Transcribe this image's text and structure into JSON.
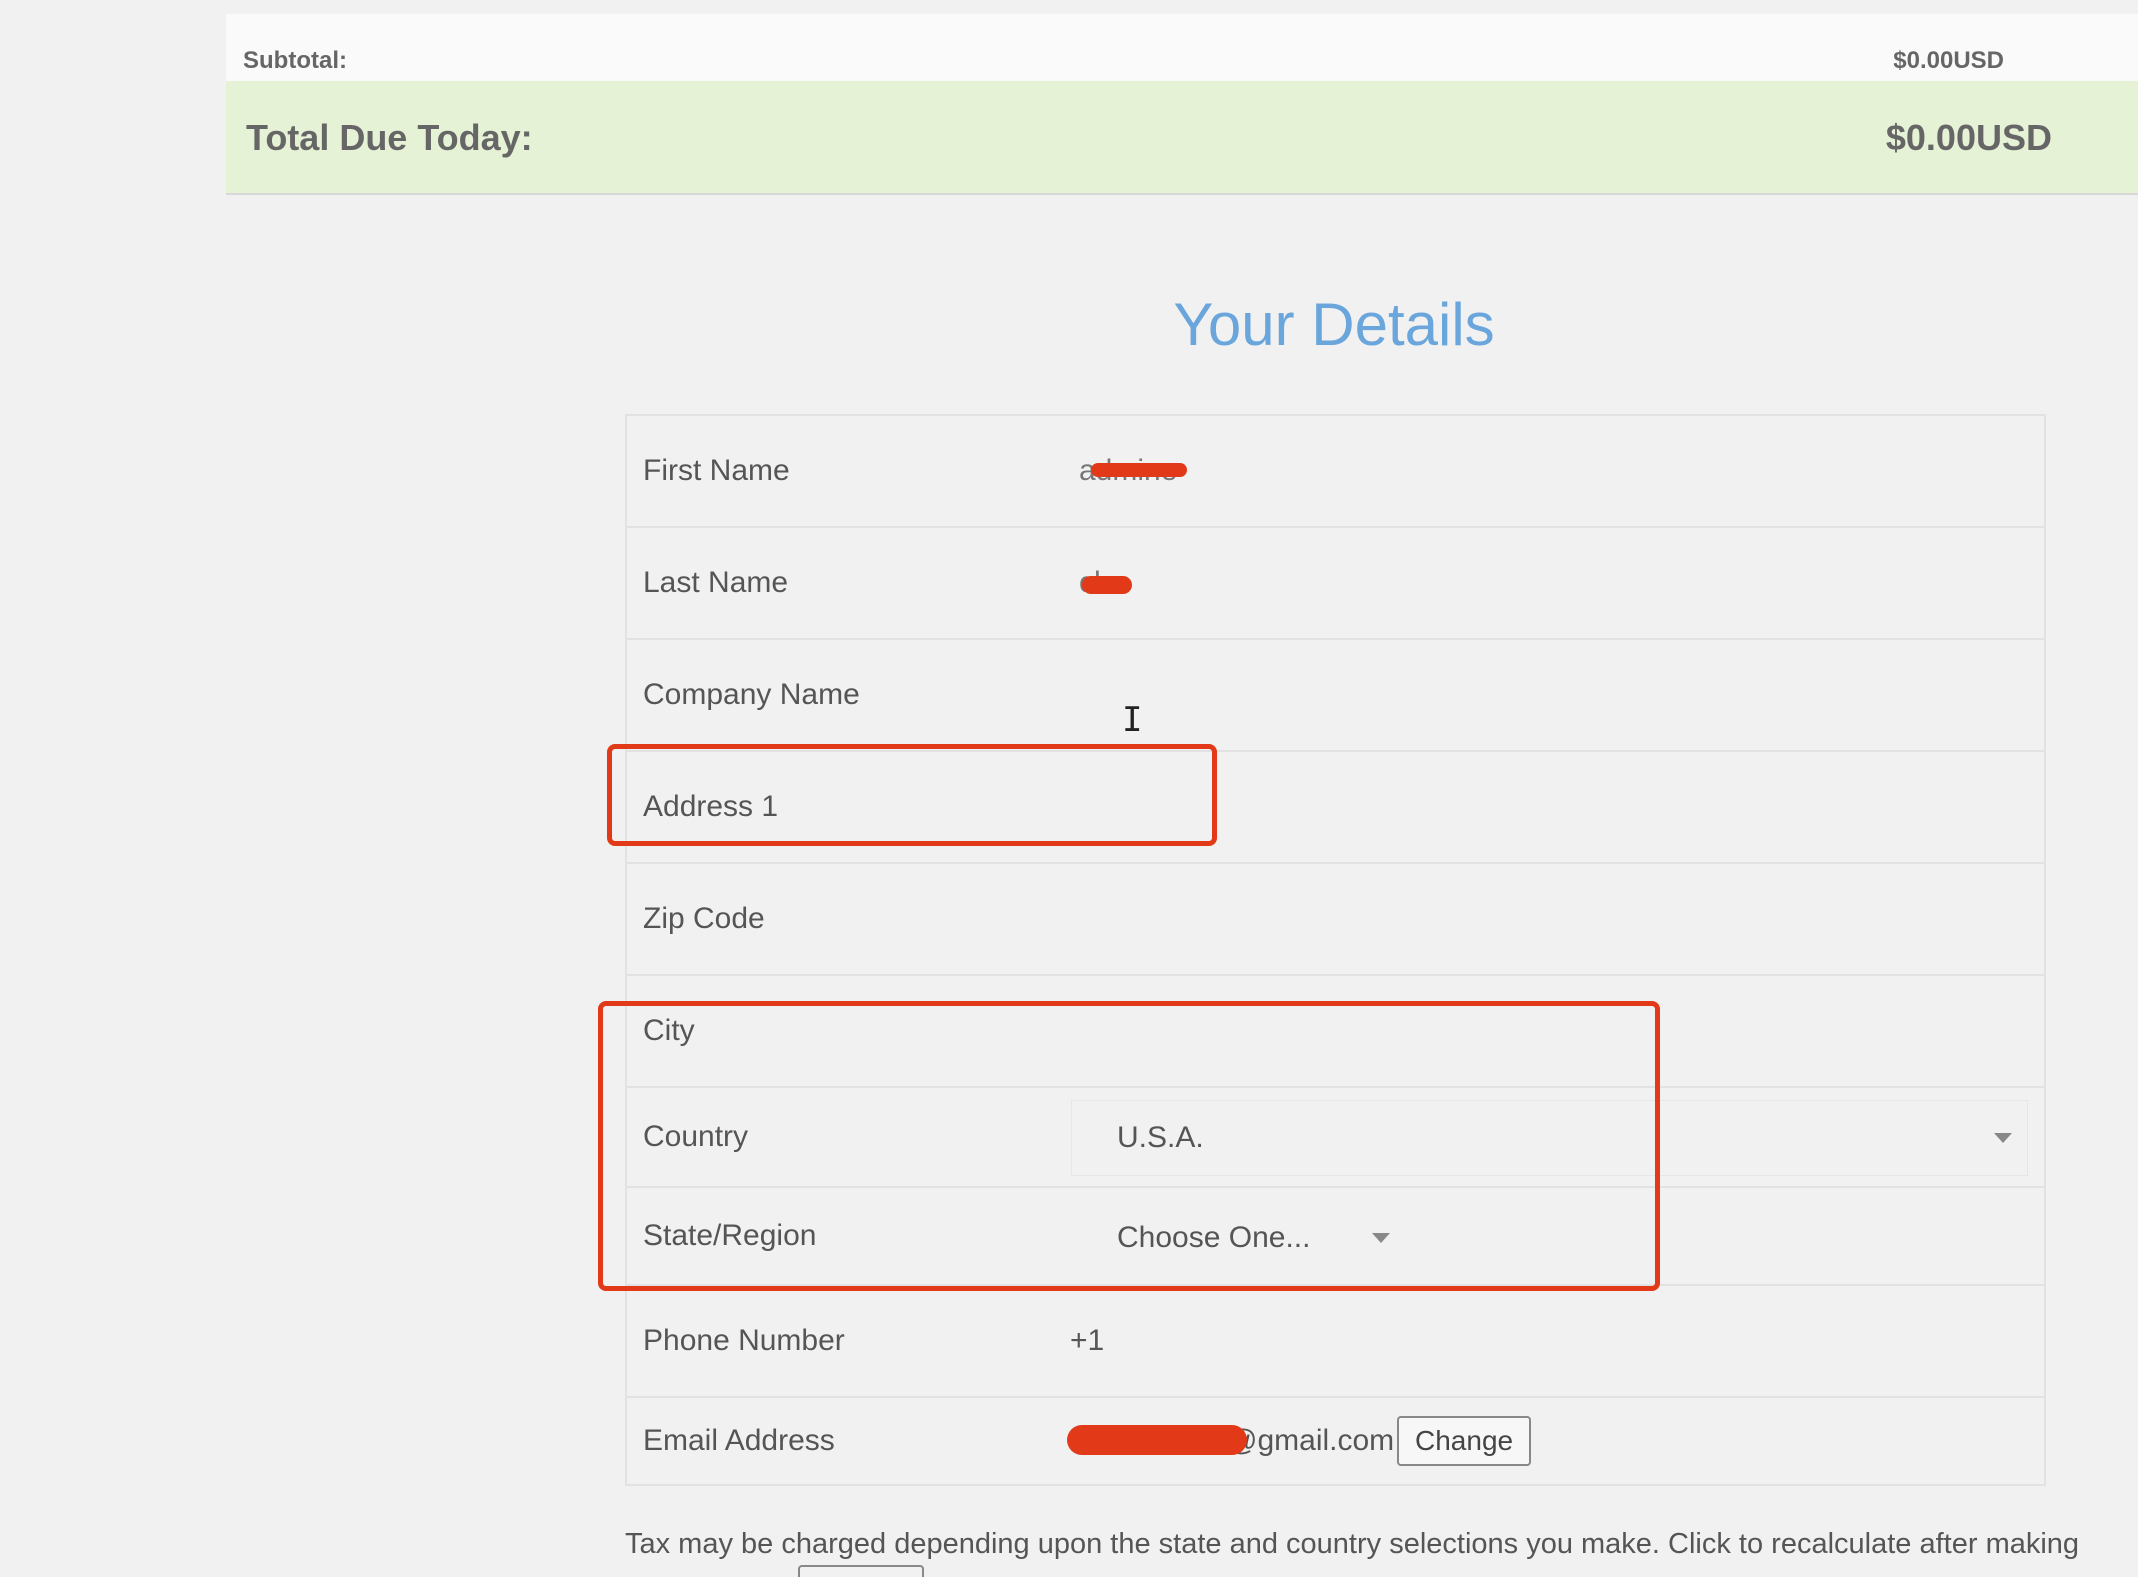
{
  "order_summary": {
    "subtotal_label": "Subtotal:",
    "subtotal_value": "$0.00USD",
    "total_label": "Total Due Today:",
    "total_value": "$0.00USD"
  },
  "details": {
    "title": "Your Details",
    "fields": {
      "first_name": {
        "label": "First Name",
        "value": "admine"
      },
      "last_name": {
        "label": "Last Name",
        "value": "chu"
      },
      "company_name": {
        "label": "Company Name",
        "value": ""
      },
      "address1": {
        "label": "Address 1",
        "value": ""
      },
      "zip_code": {
        "label": "Zip Code",
        "value": ""
      },
      "city": {
        "label": "City",
        "value": ""
      },
      "country": {
        "label": "Country",
        "selected": "U.S.A."
      },
      "state": {
        "label": "State/Region",
        "selected": "Choose One..."
      },
      "phone": {
        "label": "Phone Number",
        "value": "+1"
      },
      "email": {
        "label": "Email Address",
        "value": "@gmail.com",
        "change_label": "Change"
      }
    }
  },
  "tax_note": "Tax may be charged depending upon the state and country selections you make. Click to recalculate after making",
  "annotation_color": "#e23a18",
  "accent_color": "#6aa6dc",
  "total_bg_color": "#e5f2d5",
  "icons": {
    "dropdown": "chevron-down-icon",
    "cursor": "text-cursor-icon"
  }
}
